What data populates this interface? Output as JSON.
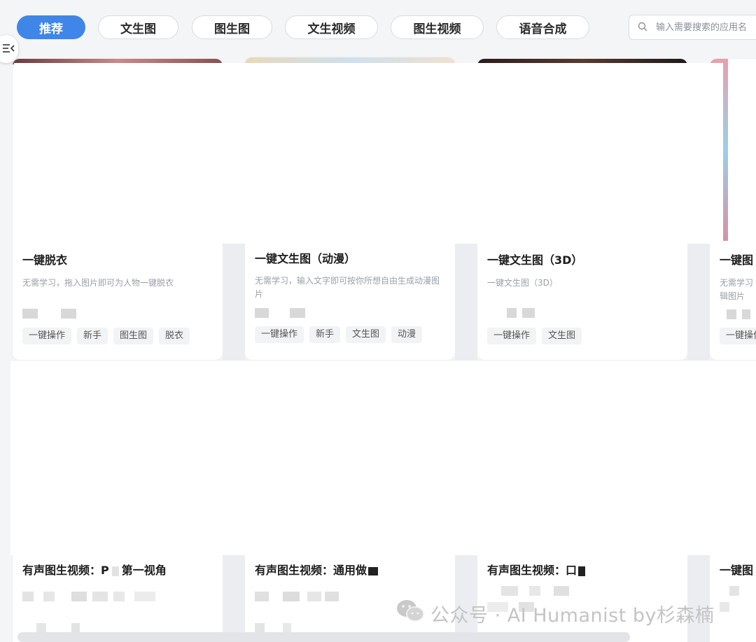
{
  "filters": {
    "tabs": [
      {
        "label": "推荐",
        "active": true
      },
      {
        "label": "文生图",
        "active": false
      },
      {
        "label": "图生图",
        "active": false
      },
      {
        "label": "文生视频",
        "active": false
      },
      {
        "label": "图生视频",
        "active": false
      },
      {
        "label": "语音合成",
        "active": false
      }
    ],
    "search_placeholder": "输入需要搜索的应用名"
  },
  "accent_color": "#3f86e8",
  "cards_row1": [
    {
      "title": "一键脱衣",
      "desc": "无需学习，拖入图片即可为人物一键脱衣",
      "tags": [
        "一键操作",
        "新手",
        "图生图",
        "脱衣"
      ]
    },
    {
      "title": "一键文生图（动漫）",
      "desc": "无需学习，输入文字即可按你所想自由生成动漫图片",
      "tags": [
        "一键操作",
        "新手",
        "文生图",
        "动漫"
      ]
    },
    {
      "title": "一键文生图（3D）",
      "desc": "一键文生图（3D）",
      "tags": [
        "一键操作",
        "文生图"
      ]
    },
    {
      "title": "一键图",
      "desc": "无需学习",
      "desc2": "辑图片",
      "tags": [
        "一键操作"
      ]
    }
  ],
  "cards_row2": [
    {
      "title": "有声图生视频：P",
      "title_tail": "第一视角"
    },
    {
      "title": "有声图生视频：通用做"
    },
    {
      "title": "有声图生视频：口"
    },
    {
      "title": "一键图"
    }
  ],
  "watermark": {
    "text": "公众号 · AI Humanist by杉森楠",
    "icon": "wechat-icon"
  }
}
